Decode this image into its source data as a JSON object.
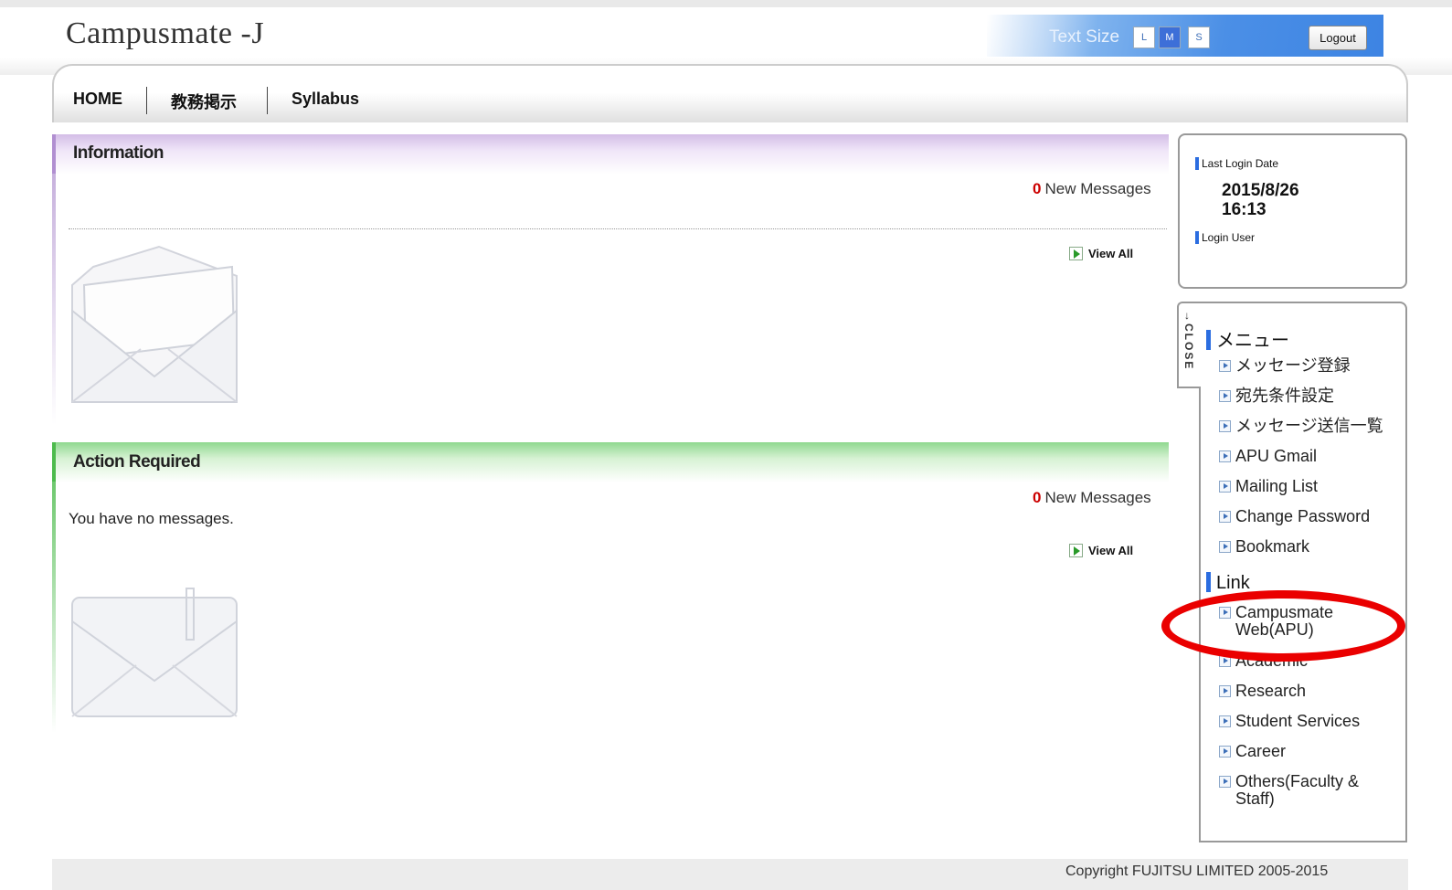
{
  "header": {
    "logo": "Campusmate -J",
    "text_size_label": "Text Size",
    "text_size_buttons": [
      "L",
      "M",
      "S"
    ],
    "logout_label": "Logout"
  },
  "nav": {
    "items": [
      "HOME",
      "教務掲示",
      "Syllabus"
    ]
  },
  "information": {
    "title": "Information",
    "new_count": "0",
    "new_label": "New Messages",
    "view_all": "View All"
  },
  "action_required": {
    "title": "Action Required",
    "new_count": "0",
    "new_label": "New Messages",
    "empty_text": "You have no messages.",
    "view_all": "View All"
  },
  "login_info": {
    "last_login_label": "Last Login Date",
    "last_login_date": "2015/8/26",
    "last_login_time": "16:13",
    "login_user_label": "Login User"
  },
  "side_menu": {
    "close_label": "CLOSE",
    "close_arrow": "→",
    "menu_title": "メニュー",
    "menu_items": [
      "メッセージ登録",
      "宛先条件設定",
      "メッセージ送信一覧",
      "APU Gmail",
      "Mailing List",
      "Change Password",
      "Bookmark"
    ],
    "link_title": "Link",
    "link_items": [
      "Campusmate Web(APU)",
      "Academic",
      "Research",
      "Student Services",
      "Career",
      "Others(Faculty & Staff)"
    ]
  },
  "footer": {
    "copyright": "Copyright FUJITSU LIMITED 2005-2015"
  },
  "colors": {
    "accent_blue": "#3d84e3",
    "info_purple": "#b18fd1",
    "action_green": "#4dbb4d",
    "count_red": "#cc0000",
    "highlight_red": "#ea0000"
  }
}
